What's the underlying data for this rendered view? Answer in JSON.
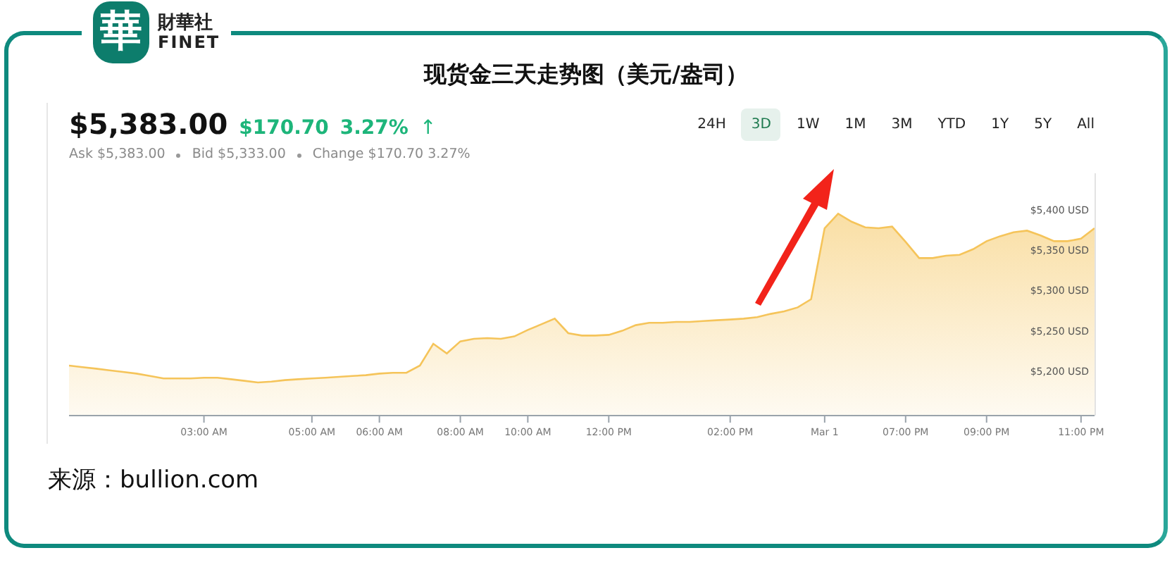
{
  "logo": {
    "mark": "華",
    "name_zh": "財華社",
    "name_en": "FINET"
  },
  "title": "现货金三天走势图（美元/盎司）",
  "quote": {
    "price": "$5,383.00",
    "change": "$170.70",
    "percent": "3.27%",
    "arrow": "↑",
    "details": [
      "Ask $5,383.00",
      "Bid $5,333.00",
      "Change $170.70 3.27%"
    ]
  },
  "ranges": [
    {
      "label": "24H",
      "selected": false
    },
    {
      "label": "3D",
      "selected": true
    },
    {
      "label": "1W",
      "selected": false
    },
    {
      "label": "1M",
      "selected": false
    },
    {
      "label": "3M",
      "selected": false
    },
    {
      "label": "YTD",
      "selected": false
    },
    {
      "label": "1Y",
      "selected": false
    },
    {
      "label": "5Y",
      "selected": false
    },
    {
      "label": "All",
      "selected": false
    }
  ],
  "chart": {
    "chart_data": {
      "type": "area",
      "categories": [
        null,
        null,
        null,
        null,
        null,
        null,
        null,
        null,
        null,
        null,
        "03:00 AM",
        null,
        null,
        null,
        null,
        null,
        null,
        null,
        "05:00 AM",
        null,
        null,
        null,
        null,
        "06:00 AM",
        null,
        null,
        null,
        null,
        null,
        "08:00 AM",
        null,
        null,
        null,
        null,
        "10:00 AM",
        null,
        null,
        null,
        null,
        null,
        "12:00 PM",
        null,
        null,
        null,
        null,
        null,
        null,
        null,
        null,
        "02:00 PM",
        null,
        null,
        null,
        null,
        null,
        null,
        "Mar 1",
        null,
        null,
        null,
        null,
        null,
        "07:00 PM",
        null,
        null,
        null,
        null,
        null,
        "09:00 PM",
        null,
        null,
        null,
        null,
        null,
        null,
        "11:00 PM",
        null
      ],
      "series": [
        {
          "color": "#f5c45a",
          "values": [
            5207,
            5205,
            5203,
            5201,
            5199,
            5197,
            5194,
            5191,
            5191,
            5191,
            5192,
            5192,
            5190,
            5188,
            5186,
            5187,
            5189,
            5190,
            5191,
            5192,
            5193,
            5194,
            5195,
            5197,
            5198,
            5198,
            5207,
            5234,
            5222,
            5237,
            5240,
            5241,
            5240,
            5243,
            5251,
            5258,
            5265,
            5247,
            5244,
            5244,
            5245,
            5250,
            5257,
            5260,
            5260,
            5261,
            5261,
            5262,
            5263,
            5264,
            5265,
            5267,
            5271,
            5274,
            5279,
            5289,
            5377,
            5395,
            5385,
            5378,
            5377,
            5379,
            5360,
            5340,
            5340,
            5343,
            5344,
            5351,
            5361,
            5367,
            5372,
            5374,
            5368,
            5361,
            5361,
            5364,
            5377
          ]
        }
      ],
      "ylim": [
        5145,
        5445
      ],
      "yticks": [
        {
          "value": 5400,
          "label": "$5,400 USD"
        },
        {
          "value": 5350,
          "label": "$5,350 USD"
        },
        {
          "value": 5300,
          "label": "$5,300 USD"
        },
        {
          "value": 5250,
          "label": "$5,250 USD"
        },
        {
          "value": 5200,
          "label": "$5,200 USD"
        }
      ]
    }
  },
  "source": "来源：bullion.com"
}
